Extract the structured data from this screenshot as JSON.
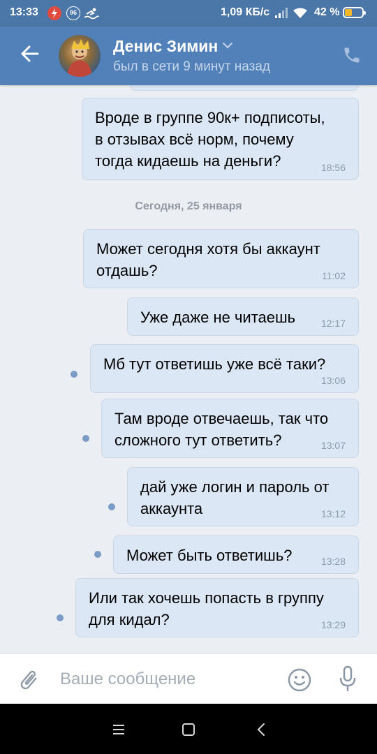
{
  "status_bar": {
    "time": "13:33",
    "notif_badge": "96",
    "network_speed": "1,09 КБ/с",
    "battery_percent": "42 %",
    "battery_level": 0.42,
    "battery_color": "#f3b82a"
  },
  "header": {
    "contact_name": "Денис Зимин",
    "last_seen": "был в сети 9 минут назад",
    "icons": [
      "arrow-left-icon",
      "chevron-down-icon",
      "phone-icon"
    ],
    "bg_color": "#5181b8"
  },
  "chat": {
    "previous_message": {
      "text": "Вроде в группе 90к+ подписоты,\nв отзывах всё норм, почему\nтогда кидаешь на деньги?",
      "time": "18:56"
    },
    "date_separator": "Сегодня, 25 января",
    "messages": [
      {
        "text": "Может сегодня хотя бы аккаунт\nотдашь?",
        "time": "11:02",
        "unread": false
      },
      {
        "text": "Уже даже не читаешь",
        "time": "12:17",
        "unread": false
      },
      {
        "text": "Мб тут ответишь уже всё таки?",
        "time": "13:06",
        "unread": true
      },
      {
        "text": "Там вроде отвечаешь, так что\nсложного тут ответить?",
        "time": "13:07",
        "unread": true
      },
      {
        "text": "дай уже логин и пароль от\nаккаунта",
        "time": "13:12",
        "unread": true
      },
      {
        "text": "Может быть ответишь?",
        "time": "13:28",
        "unread": true
      },
      {
        "text": "Или так хочешь попасть в группу\nдля кидал?",
        "time": "13:29",
        "unread": true
      }
    ],
    "bubble_color": "#dbe7f5",
    "unread_dot_color": "#7a9cc6"
  },
  "input": {
    "placeholder": "Ваше сообщение",
    "icons": [
      "paperclip-icon",
      "smiley-icon",
      "microphone-icon"
    ]
  },
  "navbar": {
    "icons": [
      "menu-icon",
      "home-square-icon",
      "back-chevron-icon"
    ]
  }
}
